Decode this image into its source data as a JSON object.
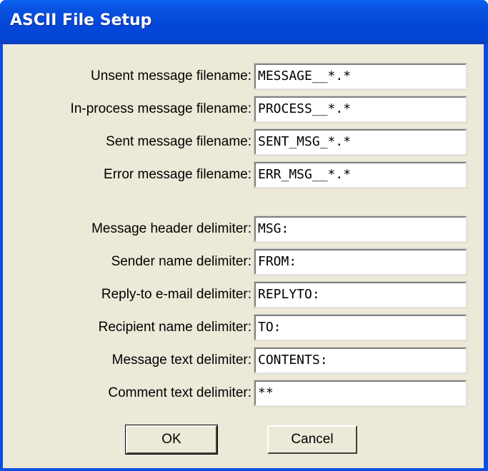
{
  "window": {
    "title": "ASCII File Setup"
  },
  "fields": [
    {
      "label": "Unsent message filename:",
      "value": "MESSAGE__*.*"
    },
    {
      "label": "In-process message filename:",
      "value": "PROCESS__*.*"
    },
    {
      "label": "Sent message filename:",
      "value": "SENT_MSG_*.*"
    },
    {
      "label": "Error message filename:",
      "value": "ERR_MSG__*.*"
    },
    {
      "label": "Message header delimiter:",
      "value": "MSG:"
    },
    {
      "label": "Sender name delimiter:",
      "value": "FROM:"
    },
    {
      "label": "Reply-to e-mail delimiter:",
      "value": "REPLYTO:"
    },
    {
      "label": "Recipient name delimiter:",
      "value": "TO:"
    },
    {
      "label": "Message text delimiter:",
      "value": "CONTENTS:"
    },
    {
      "label": "Comment text delimiter:",
      "value": "**"
    }
  ],
  "buttons": {
    "ok_label": "OK",
    "cancel_label": "Cancel"
  }
}
